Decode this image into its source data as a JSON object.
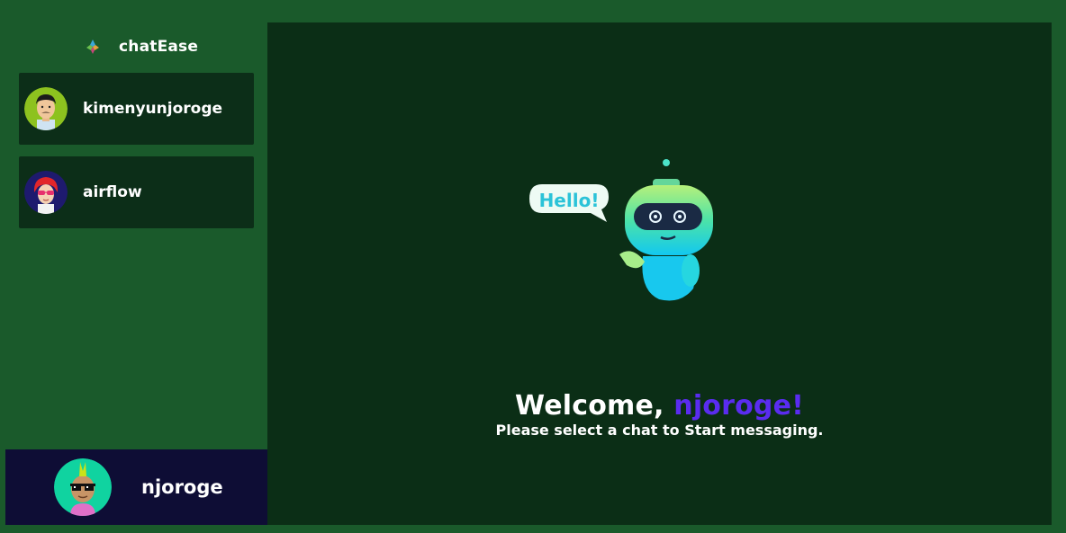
{
  "app": {
    "name": "chatEase"
  },
  "contacts": [
    {
      "name": "kimenyunjoroge",
      "avatar": "man-with-mustache-avatar"
    },
    {
      "name": "airflow",
      "avatar": "woman-with-red-hair-sunglasses-avatar"
    }
  ],
  "current_user": {
    "name": "njoroge",
    "avatar": "mohawk-pixel-sunglasses-avatar"
  },
  "welcome": {
    "prefix": "Welcome, ",
    "username": "njoroge!",
    "subtitle": "Please select a chat to Start messaging."
  },
  "illustration": {
    "bubble_text": "Hello!",
    "icon": "robot-waving-icon"
  },
  "colors": {
    "background": "#1a5a2b",
    "card": "#0c2e18",
    "main_panel": "#0b2e16",
    "user_bar": "#0e0d35",
    "accent": "#5a2cf0"
  }
}
